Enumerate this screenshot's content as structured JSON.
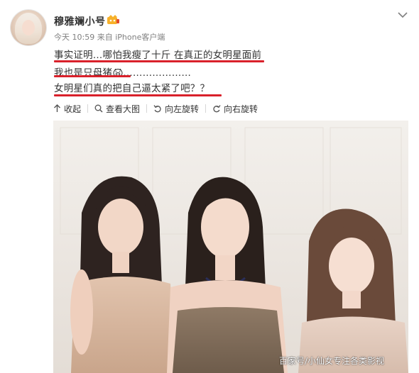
{
  "post": {
    "username": "穆雅斓小号",
    "time": "今天 10:59",
    "source_prefix": "来自",
    "source": "iPhone客户端",
    "line1": "事实证明…哪怕我瘦了十斤 在真正的女明星面前",
    "line2_text": "我也是只母猪",
    "line2_dots": "…………………",
    "line3": "女明星们真的把自己逼太紧了吧？？"
  },
  "actions": {
    "collapse": "收起",
    "view_large": "查看大图",
    "rotate_left": "向左旋转",
    "rotate_right": "向右旋转"
  },
  "photo": {
    "watermark": "百家号/小仙女专注各类影视"
  },
  "colors": {
    "underline": "#d9212b",
    "text": "#333333",
    "meta": "#808080"
  },
  "icons": [
    "vip-badge-icon",
    "chevron-down-icon",
    "collapse-icon",
    "view-large-icon",
    "rotate-left-icon",
    "rotate-right-icon",
    "pig-emoji-icon"
  ]
}
